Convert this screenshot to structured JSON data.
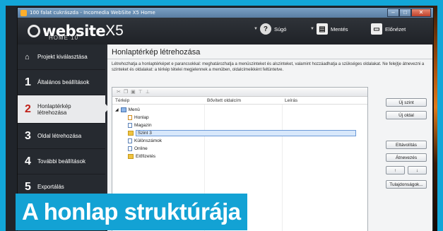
{
  "window": {
    "title": "100 falat cukrászda - Incomedia WebSite X5 Home"
  },
  "logo": {
    "word": "website",
    "suffix": "X5",
    "edition": "HOME 10"
  },
  "header_buttons": [
    {
      "label": "Súgó",
      "icon": "help-icon"
    },
    {
      "label": "Mentés",
      "icon": "save-icon"
    },
    {
      "label": "Előnézet",
      "icon": "preview-icon"
    }
  ],
  "sidebar": {
    "items": [
      {
        "num": "",
        "label": "Projekt kiválasztása",
        "icon": "home-icon"
      },
      {
        "num": "1",
        "label": "Általános beállítások"
      },
      {
        "num": "2",
        "label": "Honlaptérkép létrehozása",
        "active": true
      },
      {
        "num": "3",
        "label": "Oldal létrehozása"
      },
      {
        "num": "4",
        "label": "További beállítások"
      },
      {
        "num": "5",
        "label": "Exportálás"
      }
    ]
  },
  "main": {
    "title": "Honlaptérkép létrehozása",
    "description": "Létrehozhatja a honlaptérképet e parancsokkal: meghatározhatja a menüszinteket és alszinteket, valamint hozzáadhatja a szükséges oldalakat. Ne felejtje átnevezni a szinteket és oldalakat: a térkép tételei megjelennek a menüben, oldalcímeikként feltüntetve.",
    "columns": [
      "Térkép",
      "Bővített oldalcím",
      "Leírás"
    ],
    "tree": [
      {
        "label": "Menü",
        "type": "root",
        "depth": 0
      },
      {
        "label": "Honlap",
        "type": "home",
        "depth": 1
      },
      {
        "label": "Magazin",
        "type": "page",
        "depth": 1
      },
      {
        "label": "Szint 3",
        "type": "folder",
        "depth": 1,
        "selected": true
      },
      {
        "label": "Különszámok",
        "type": "page",
        "depth": 1
      },
      {
        "label": "Online",
        "type": "page",
        "depth": 1
      },
      {
        "label": "Előfizetés",
        "type": "folder",
        "depth": 1
      }
    ],
    "buttons": {
      "new_level": "Új szint",
      "new_page": "Új oldal",
      "remove": "Eltávolítás",
      "rename": "Átnevezés",
      "up": "↑",
      "down": "↓",
      "properties": "Tulajdonságok..."
    }
  },
  "caption": "A honlap struktúrája"
}
